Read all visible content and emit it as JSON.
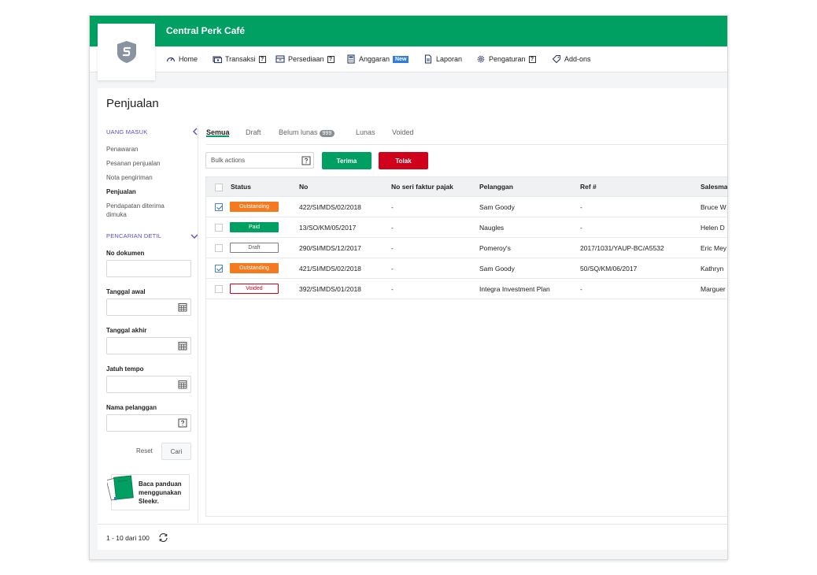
{
  "app": {
    "company_name": "Central Perk Café"
  },
  "nav": {
    "home": "Home",
    "transaksi": "Transaksi",
    "persediaan": "Persediaan",
    "anggaran": "Anggaran",
    "anggaran_badge": "New",
    "laporan": "Laporan",
    "pengaturan": "Pengaturan",
    "addons": "Add-ons",
    "help_glyph": "?"
  },
  "page": {
    "title": "Penjualan"
  },
  "sidebar": {
    "uang_masuk_title": "UANG MASUK",
    "items": [
      {
        "label": "Penawaran",
        "active": false
      },
      {
        "label": "Pesanan penjualan",
        "active": false
      },
      {
        "label": "Nota pengiriman",
        "active": false
      },
      {
        "label": "Penjualan",
        "active": true
      },
      {
        "label": "Pendapatan diterima dimuka",
        "active": false
      }
    ],
    "search_title": "PENCARIAN DETIL",
    "fields": {
      "no_dokumen": "No dokumen",
      "tanggal_awal": "Tanggal awal",
      "tanggal_akhir": "Tanggal akhir",
      "jatuh_tempo": "Jatuh tempo",
      "nama_pelanggan": "Nama pelanggan"
    },
    "reset_label": "Reset",
    "cari_label": "Cari",
    "guide_text": "Baca panduan menggunakan Sleekr."
  },
  "tabs": {
    "semua": "Semua",
    "draft": "Draft",
    "belum_lunas": "Belum lunas",
    "belum_lunas_count": "999",
    "lunas": "Lunas",
    "voided": "Voided"
  },
  "toolbar": {
    "bulk_placeholder": "Bulk actions",
    "terima_label": "Terima",
    "tolak_label": "Tolak"
  },
  "table": {
    "headers": {
      "status": "Status",
      "no": "No",
      "no_seri": "No seri faktur pajak",
      "pelanggan": "Pelanggan",
      "ref": "Ref #",
      "salesman": "Salesman"
    },
    "rows": [
      {
        "checked": true,
        "status": "Outstanding",
        "no": "422/SI/MDS/02/2018",
        "no_seri": "-",
        "pelanggan": "Sam Goody",
        "ref": "-",
        "salesman": "Bruce W"
      },
      {
        "checked": false,
        "status": "Paid",
        "no": "13/SO/KM/05/2017",
        "no_seri": "-",
        "pelanggan": "Naugles",
        "ref": "-",
        "salesman": "Helen D"
      },
      {
        "checked": false,
        "status": "Draft",
        "no": "290/SI/MDS/12/2017",
        "no_seri": "-",
        "pelanggan": "Pomeroy's",
        "ref": "2017/1031/YAUP-BC/A5532",
        "salesman": "Eric Mey"
      },
      {
        "checked": true,
        "status": "Outstanding",
        "no": "421/SI/MDS/02/2018",
        "no_seri": "-",
        "pelanggan": "Sam Goody",
        "ref": "50/SQ/KM/06/2017",
        "salesman": "Kathryn"
      },
      {
        "checked": false,
        "status": "Voided",
        "no": "392/SI/MDS/01/2018",
        "no_seri": "-",
        "pelanggan": "Integra Investment Plan",
        "ref": "-",
        "salesman": "Marguer"
      }
    ]
  },
  "pagination": {
    "range_text": "1 - 10 dari 100"
  },
  "colors": {
    "brand_green": "#00a063",
    "outstanding": "#f47a1f",
    "paid": "#00a063",
    "draft_border": "#7a7f85",
    "voided": "#d0021b",
    "tolak": "#d0021b",
    "section_purple": "#5a4fcf",
    "new_badge": "#2f7de1"
  }
}
